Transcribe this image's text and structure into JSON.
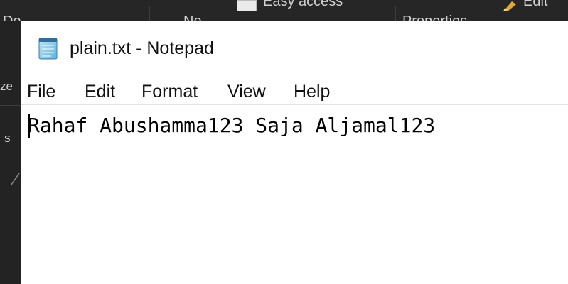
{
  "background_window": {
    "ribbon_fragments": [
      "De",
      "Ne",
      "Easy access",
      "Properties",
      "Edit"
    ],
    "left_fragments": [
      "ze",
      "s"
    ]
  },
  "notepad": {
    "title": "plain.txt - Notepad",
    "menu": [
      "File",
      "Edit",
      "Format",
      "View",
      "Help"
    ],
    "content": "Rahaf Abushamma123 Saja Aljamal123"
  },
  "colors": {
    "window_bg": "#ffffff",
    "desktop_bg": "#1f1f1f",
    "text": "#000000"
  },
  "icons": {
    "app_icon": "notepad-icon",
    "bg_doc_icon": "document-icon",
    "bg_edit_icon": "edit-icon"
  }
}
